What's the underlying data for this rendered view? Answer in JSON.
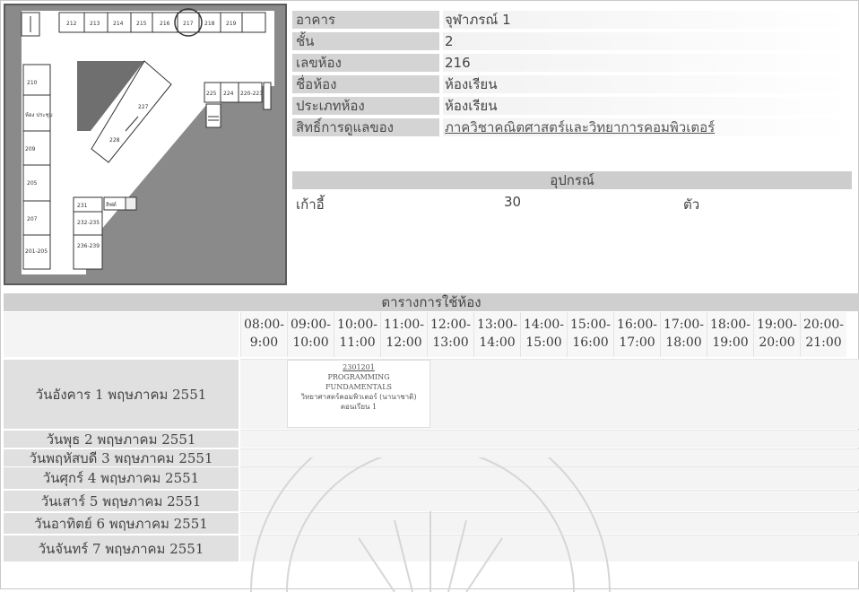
{
  "floorplan": {
    "top_rooms": [
      "212",
      "213",
      "214",
      "215",
      "216",
      "217",
      "218",
      "219"
    ],
    "left_rooms": [
      "210",
      "209",
      "208",
      "205",
      "207",
      "201-205"
    ],
    "left_note": "ห้อง ประชุม",
    "center_rooms": [
      "227",
      "228"
    ],
    "right_rooms": [
      "225",
      "224",
      "220-223"
    ],
    "bottom_rooms": [
      "231",
      "232-235",
      "236-239"
    ],
    "stair_label": "ลิฟต์",
    "toilet_label": "ห้องน้ำ"
  },
  "room_info": {
    "rows": [
      {
        "label": "อาคาร",
        "value": "จุฬาภรณ์ 1"
      },
      {
        "label": "ชั้น",
        "value": "2"
      },
      {
        "label": "เลขห้อง",
        "value": "216"
      },
      {
        "label": "ชื่อห้อง",
        "value": "ห้องเรียน"
      },
      {
        "label": "ประเภทห้อง",
        "value": "ห้องเรียน"
      }
    ],
    "owner_label": "สิทธิ์การดูแลของ",
    "owner_value": "ภาควิชาคณิตศาสตร์และวิทยาการคอมพิวเตอร์"
  },
  "equipment": {
    "header": "อุปกรณ์",
    "item_name": "เก้าอี้",
    "item_count": "30",
    "item_unit": "ตัว"
  },
  "schedule": {
    "title": "ตารางการใช้ห้อง",
    "time_slots": [
      {
        "start": "08:00-",
        "end": "9:00"
      },
      {
        "start": "09:00-",
        "end": "10:00"
      },
      {
        "start": "10:00-",
        "end": "11:00"
      },
      {
        "start": "11:00-",
        "end": "12:00"
      },
      {
        "start": "12:00-",
        "end": "13:00"
      },
      {
        "start": "13:00-",
        "end": "14:00"
      },
      {
        "start": "14:00-",
        "end": "15:00"
      },
      {
        "start": "15:00-",
        "end": "16:00"
      },
      {
        "start": "16:00-",
        "end": "17:00"
      },
      {
        "start": "17:00-",
        "end": "18:00"
      },
      {
        "start": "18:00-",
        "end": "19:00"
      },
      {
        "start": "19:00-",
        "end": "20:00"
      },
      {
        "start": "20:00-",
        "end": "21:00"
      }
    ],
    "days": [
      "วันอังคาร 1 พฤษภาคม 2551",
      "วันพุธ 2 พฤษภาคม 2551",
      "วันพฤหัสบดี 3 พฤษภาคม 2551",
      "วันศุกร์ 4 พฤษภาคม 2551",
      "วันเสาร์ 5 พฤษภาคม 2551",
      "วันอาทิตย์ 6 พฤษภาคม 2551",
      "วันจันทร์ 7 พฤษภาคม 2551"
    ],
    "booking": {
      "code": "2301201",
      "course_line1": "PROGRAMMING",
      "course_line2": "FUNDAMENTALS",
      "department": "วิทยาศาสตร์คอมพิวเตอร์ (นานาชาติ)",
      "section": "ตอนเรียน 1"
    }
  },
  "colors": {
    "label_bg": "#d4d4d4",
    "plan_dark": "#8a8a8a",
    "header_bg": "#cfcfcf"
  }
}
